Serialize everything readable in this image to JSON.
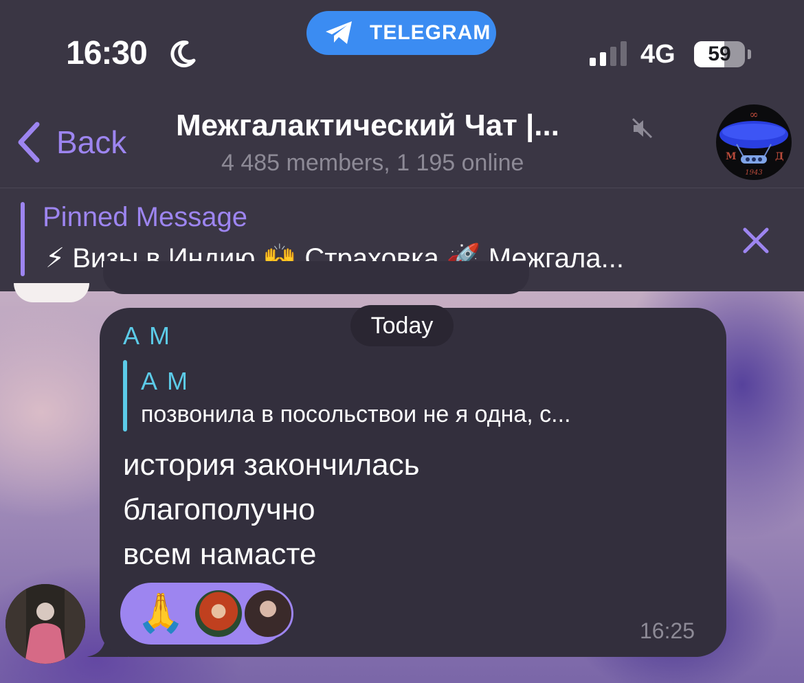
{
  "status_bar": {
    "time": "16:30",
    "moon_icon": "moon-icon",
    "app_pill": "TELEGRAM",
    "network": "4G",
    "battery": "59",
    "battery_level": 0.59
  },
  "header": {
    "back_label": "Back",
    "title": "Межгалактический Чат |...",
    "subtitle": "4 485 members, 1 195 online",
    "avatar_text": {
      "top": "∞",
      "left": "М",
      "right": "Д",
      "year": "1943"
    },
    "muted": true
  },
  "pinned": {
    "title": "Pinned Message",
    "text": "⚡ Визы в Индию 🙌 Страховка 🚀 Межгала..."
  },
  "date_divider": "Today",
  "message": {
    "sender": "А М",
    "reply": {
      "name": "А М",
      "text": "позвонила в посольствои  не я одна, с..."
    },
    "lines": [
      "история закончилась",
      "благополучно",
      "всем намасте"
    ],
    "reaction_emoji": "🙏",
    "time": "16:25"
  },
  "colors": {
    "accent": "#9d85f0",
    "sender": "#5ccbe8",
    "bar_bg": "#3a3644",
    "bubble_bg": "#332f3d",
    "telegram_blue": "#3b8cf2"
  }
}
